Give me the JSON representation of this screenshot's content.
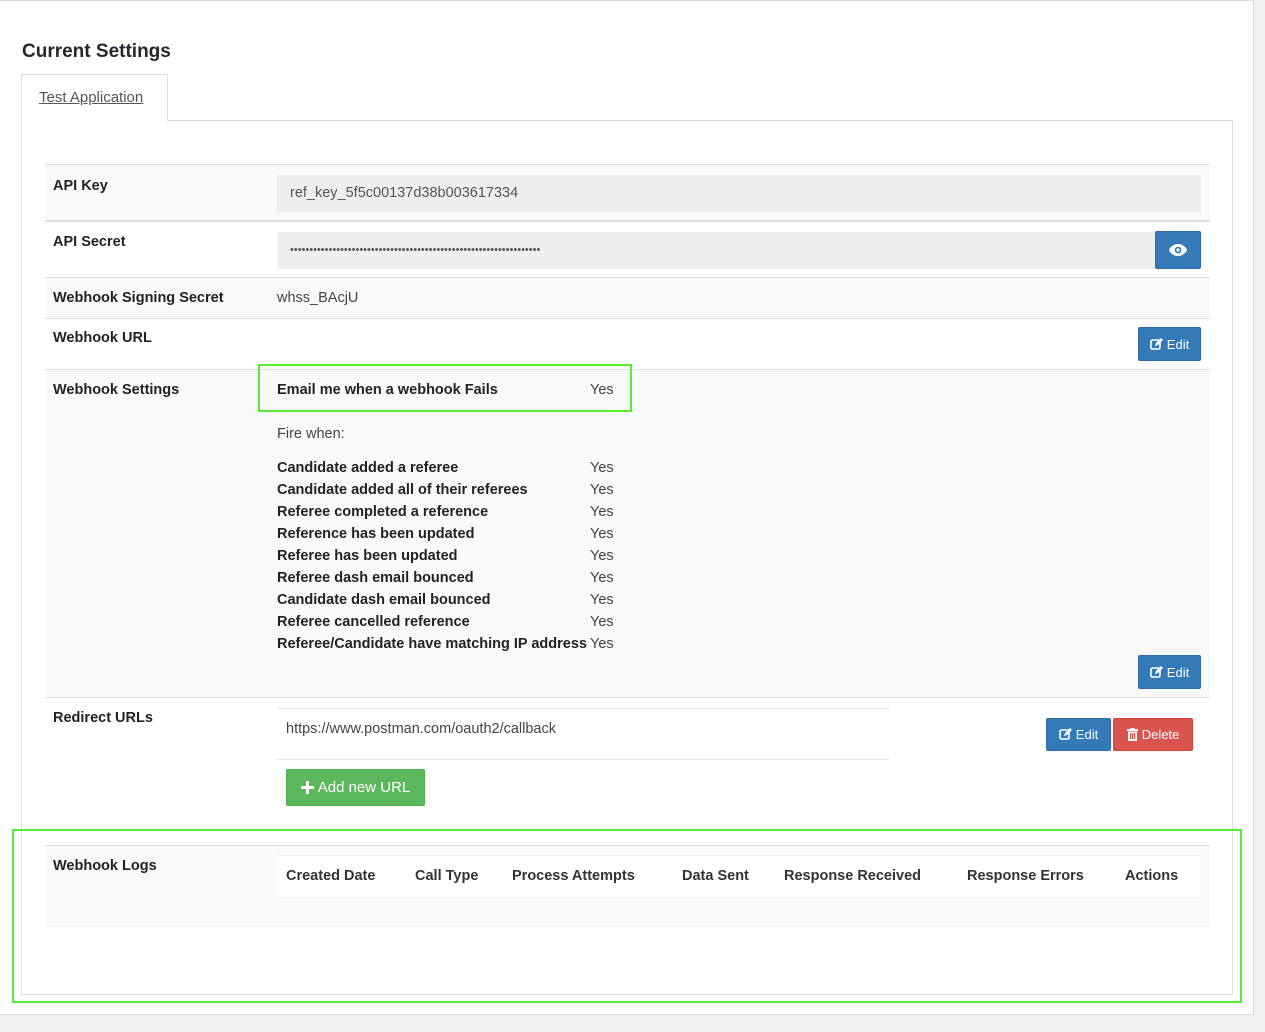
{
  "page": {
    "title": "Current Settings"
  },
  "tabs": [
    {
      "label": "Test Application"
    }
  ],
  "api_key": {
    "label": "API Key",
    "value": "ref_key_5f5c00137d38b003617334"
  },
  "api_secret": {
    "label": "API Secret",
    "value": "•••••••••••••••••••••••••••••••••••••••••••••••••••••••••••••••••"
  },
  "webhook_signing_secret": {
    "label": "Webhook Signing Secret",
    "value": "whss_BAcjU"
  },
  "webhook_url": {
    "label": "Webhook URL",
    "edit_label": "Edit"
  },
  "webhook_settings": {
    "label": "Webhook Settings",
    "email_on_fail": {
      "label": "Email me when a webhook Fails",
      "value": "Yes"
    },
    "fire_when_label": "Fire when:",
    "events": [
      {
        "label": "Candidate added a referee",
        "value": "Yes"
      },
      {
        "label": "Candidate added all of their referees",
        "value": "Yes"
      },
      {
        "label": "Referee completed a reference",
        "value": "Yes"
      },
      {
        "label": "Reference has been updated",
        "value": "Yes"
      },
      {
        "label": "Referee has been updated",
        "value": "Yes"
      },
      {
        "label": "Referee dash email bounced",
        "value": "Yes"
      },
      {
        "label": "Candidate dash email bounced",
        "value": "Yes"
      },
      {
        "label": "Referee cancelled reference",
        "value": "Yes"
      },
      {
        "label": "Referee/Candidate have matching IP address",
        "value": "Yes"
      }
    ],
    "edit_label": "Edit"
  },
  "redirect_urls": {
    "label": "Redirect URLs",
    "items": [
      {
        "url": "https://www.postman.com/oauth2/callback"
      }
    ],
    "edit_label": "Edit",
    "delete_label": "Delete",
    "add_label": "Add new URL"
  },
  "webhook_logs": {
    "label": "Webhook Logs",
    "columns": [
      "Created Date",
      "Call Type",
      "Process Attempts",
      "Data Sent",
      "Response Received",
      "Response Errors",
      "Actions"
    ]
  },
  "colors": {
    "primary": "#337ab7",
    "danger": "#d9534f",
    "success": "#5cb85c",
    "highlight": "#55ee33"
  },
  "icons": {
    "reveal": "eye-icon",
    "edit": "edit-icon",
    "delete": "trash-icon",
    "add": "plus-icon"
  }
}
